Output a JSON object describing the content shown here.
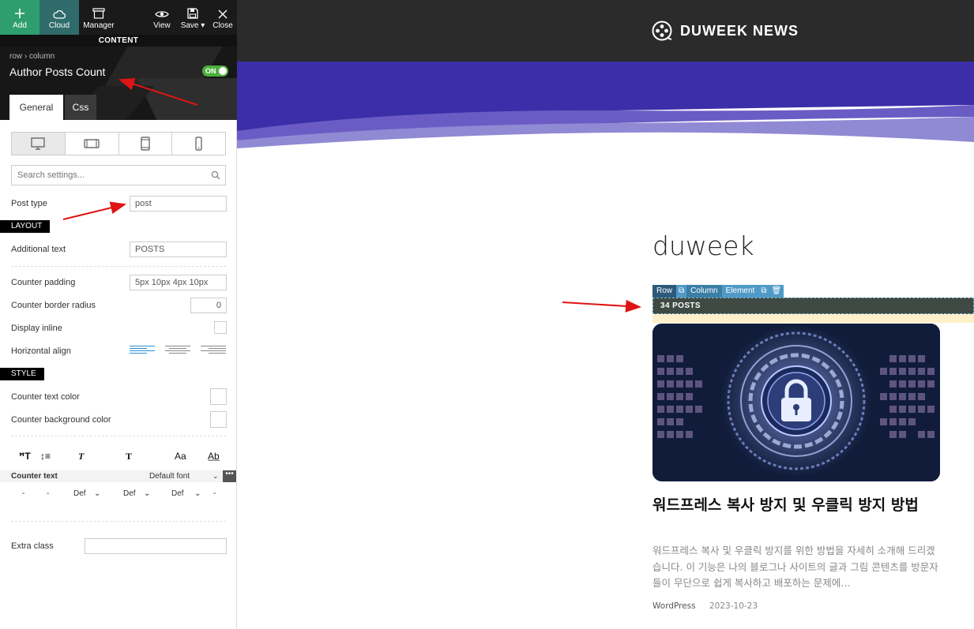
{
  "toolbar": {
    "add": "Add",
    "cloud": "Cloud",
    "manager": "Manager",
    "view": "View",
    "save": "Save",
    "close": "Close"
  },
  "content_bar": "CONTENT",
  "header": {
    "breadcrumb": "row  ›  column",
    "title": "Author Posts Count",
    "toggle": "ON"
  },
  "tabs": {
    "general": "General",
    "css": "Css"
  },
  "search": {
    "placeholder": "Search settings..."
  },
  "settings": {
    "post_type_label": "Post type",
    "post_type_value": "post",
    "layout_section": "LAYOUT",
    "additional_text_label": "Additional text",
    "additional_text_value": "POSTS",
    "counter_padding_label": "Counter padding",
    "counter_padding_value": "5px 10px 4px 10px",
    "counter_border_radius_label": "Counter border radius",
    "counter_border_radius_value": "0",
    "display_inline_label": "Display inline",
    "horizontal_align_label": "Horizontal align",
    "style_section": "STYLE",
    "counter_text_color_label": "Counter text color",
    "counter_bg_color_label": "Counter background color",
    "typo_icons": {
      "size": "ꟸT",
      "line_height": "↕≡",
      "italic": "T",
      "bold": "T",
      "case": "Aa",
      "spacing": "Ab"
    },
    "counter_text_label": "Counter text",
    "font_value": "Default font",
    "more": "•••",
    "typo_values": [
      "-",
      "-",
      "Def",
      "Def",
      "Def",
      "-"
    ],
    "extra_class_label": "Extra class"
  },
  "preview": {
    "site_name": "DUWEEK NEWS",
    "author_name": "duweek",
    "edit_bar": {
      "row": "Row",
      "column": "Column",
      "element": "Element"
    },
    "posts_count": "34 POSTS",
    "post_title": "워드프레스 복사 방지 및 우클릭 방지 방법",
    "post_excerpt": "워드프레스 복사 및 우클릭 방지를 위한 방법을 자세히 소개해 드리겠습니다. 이 기능은 나의 블로그나 사이트의 글과 그림 콘텐츠를 방문자들이 무단으로 쉽게 복사하고 배포하는 문제에…",
    "post_category": "WordPress",
    "post_date": "2023-10-23"
  },
  "colors": {
    "add_green": "#2f9e6e",
    "hero_purple": "#3b2ea8",
    "counter_bg": "#3f4a44",
    "highlight": "#fff0c9",
    "arrow_red": "#e01414"
  }
}
